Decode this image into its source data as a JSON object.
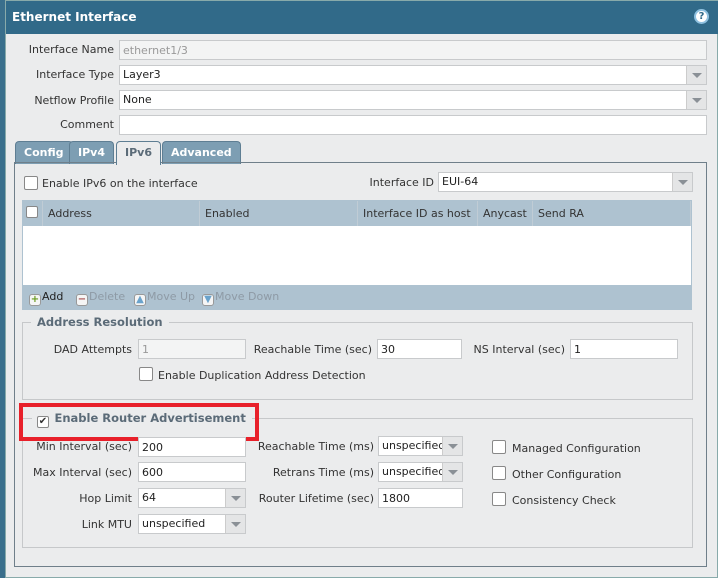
{
  "dialog": {
    "title": "Ethernet Interface",
    "help_icon": "help-icon"
  },
  "fields": {
    "interface_name": {
      "label": "Interface Name",
      "value": "ethernet1/3"
    },
    "interface_type": {
      "label": "Interface Type",
      "value": "Layer3"
    },
    "netflow_profile": {
      "label": "Netflow Profile",
      "value": "None"
    },
    "comment": {
      "label": "Comment",
      "value": ""
    }
  },
  "tabs": [
    {
      "label": "Config"
    },
    {
      "label": "IPv4"
    },
    {
      "label": "IPv6",
      "active": true
    },
    {
      "label": "Advanced"
    }
  ],
  "ipv6": {
    "enable_label": "Enable IPv6 on the interface",
    "enable_checked": false,
    "interface_id_label": "Interface ID",
    "interface_id_value": "EUI-64",
    "table": {
      "columns": [
        "Address",
        "Enabled",
        "Interface ID as host",
        "Anycast",
        "Send RA"
      ],
      "rows": []
    },
    "toolbar": {
      "add": "Add",
      "delete": "Delete",
      "move_up": "Move Up",
      "move_down": "Move Down"
    }
  },
  "address_resolution": {
    "title": "Address Resolution",
    "dad_attempts": {
      "label": "DAD Attempts",
      "value": "1"
    },
    "reachable_time": {
      "label": "Reachable Time (sec)",
      "value": "30"
    },
    "ns_interval": {
      "label": "NS Interval (sec)",
      "value": "1"
    },
    "dad_label": "Enable Duplication Address Detection",
    "dad_checked": false
  },
  "router_adv": {
    "title": "Enable Router Advertisement",
    "checked": true,
    "highlight_color": "#e8202a",
    "min_interval": {
      "label": "Min Interval (sec)",
      "value": "200"
    },
    "max_interval": {
      "label": "Max Interval (sec)",
      "value": "600"
    },
    "hop_limit": {
      "label": "Hop Limit",
      "value": "64"
    },
    "link_mtu": {
      "label": "Link MTU",
      "value": "unspecified"
    },
    "reachable_time": {
      "label": "Reachable Time (ms)",
      "value": "unspecified"
    },
    "retrans_time": {
      "label": "Retrans Time (ms)",
      "value": "unspecified"
    },
    "router_lifetime": {
      "label": "Router Lifetime (sec)",
      "value": "1800"
    },
    "managed_config": {
      "label": "Managed Configuration",
      "checked": false
    },
    "other_config": {
      "label": "Other Configuration",
      "checked": false
    },
    "consistency_check": {
      "label": "Consistency Check",
      "checked": false
    }
  }
}
